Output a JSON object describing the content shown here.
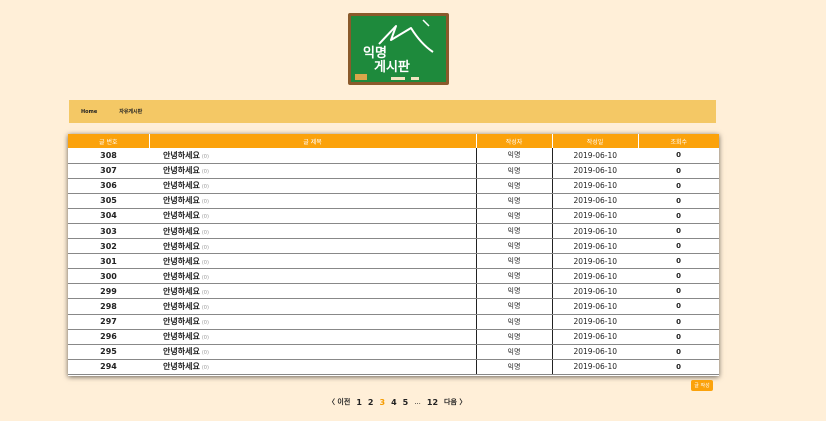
{
  "logo": {
    "line1": "익명",
    "line2": "게시판"
  },
  "breadcrumb": {
    "home": "Home",
    "current": "자유게시판"
  },
  "table": {
    "headers": [
      "글 번호",
      "글 제목",
      "작성자",
      "작성일",
      "조회수"
    ],
    "rows": [
      {
        "no": "308",
        "title": "안녕하세요",
        "comments": "(0)",
        "author": "익명",
        "date": "2019-06-10",
        "views": "0"
      },
      {
        "no": "307",
        "title": "안녕하세요",
        "comments": "(0)",
        "author": "익명",
        "date": "2019-06-10",
        "views": "0"
      },
      {
        "no": "306",
        "title": "안녕하세요",
        "comments": "(0)",
        "author": "익명",
        "date": "2019-06-10",
        "views": "0"
      },
      {
        "no": "305",
        "title": "안녕하세요",
        "comments": "(0)",
        "author": "익명",
        "date": "2019-06-10",
        "views": "0"
      },
      {
        "no": "304",
        "title": "안녕하세요",
        "comments": "(0)",
        "author": "익명",
        "date": "2019-06-10",
        "views": "0"
      },
      {
        "no": "303",
        "title": "안녕하세요",
        "comments": "(0)",
        "author": "익명",
        "date": "2019-06-10",
        "views": "0"
      },
      {
        "no": "302",
        "title": "안녕하세요",
        "comments": "(0)",
        "author": "익명",
        "date": "2019-06-10",
        "views": "0"
      },
      {
        "no": "301",
        "title": "안녕하세요",
        "comments": "(0)",
        "author": "익명",
        "date": "2019-06-10",
        "views": "0"
      },
      {
        "no": "300",
        "title": "안녕하세요",
        "comments": "(0)",
        "author": "익명",
        "date": "2019-06-10",
        "views": "0"
      },
      {
        "no": "299",
        "title": "안녕하세요",
        "comments": "(0)",
        "author": "익명",
        "date": "2019-06-10",
        "views": "0"
      },
      {
        "no": "298",
        "title": "안녕하세요",
        "comments": "(0)",
        "author": "익명",
        "date": "2019-06-10",
        "views": "0"
      },
      {
        "no": "297",
        "title": "안녕하세요",
        "comments": "(0)",
        "author": "익명",
        "date": "2019-06-10",
        "views": "0"
      },
      {
        "no": "296",
        "title": "안녕하세요",
        "comments": "(0)",
        "author": "익명",
        "date": "2019-06-10",
        "views": "0"
      },
      {
        "no": "295",
        "title": "안녕하세요",
        "comments": "(0)",
        "author": "익명",
        "date": "2019-06-10",
        "views": "0"
      },
      {
        "no": "294",
        "title": "안녕하세요",
        "comments": "(0)",
        "author": "익명",
        "date": "2019-06-10",
        "views": "0"
      }
    ]
  },
  "write_button": "글 작성",
  "pagination": {
    "prev": "〈 이전",
    "pages": [
      "1",
      "2",
      "3",
      "4",
      "5"
    ],
    "current": "3",
    "dots": "...",
    "last": "12",
    "next": "다음 〉"
  },
  "colors": {
    "background": "#ffefd8",
    "accent": "#fba20b",
    "crumb_bar": "#f4c865",
    "board": "#1e8a3c"
  }
}
